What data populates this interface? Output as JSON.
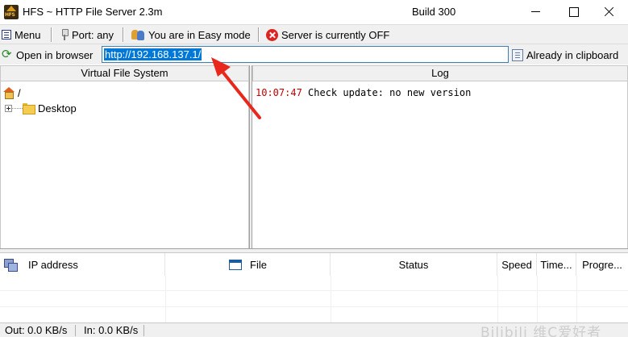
{
  "window": {
    "title": "HFS ~ HTTP File Server 2.3m",
    "build": "Build 300"
  },
  "toolbar1": {
    "menu_label": "Menu",
    "port_label": "Port: any",
    "mode_label": "You are in Easy mode",
    "server_label": "Server is currently OFF"
  },
  "toolbar2": {
    "open_browser_label": "Open in browser",
    "url_value": "http://192.168.137.1/",
    "clipboard_label": "Already in clipboard"
  },
  "vfs": {
    "header": "Virtual File System",
    "root_label": "/",
    "items": [
      {
        "label": "Desktop",
        "icon": "folder-icon"
      }
    ]
  },
  "log": {
    "header": "Log",
    "entries": [
      {
        "time": "10:07:47",
        "message": "Check update: no new version"
      }
    ]
  },
  "connections": {
    "columns": {
      "ip": "IP address",
      "file": "File",
      "status": "Status",
      "speed": "Speed",
      "time": "Time...",
      "progress": "Progre..."
    }
  },
  "statusbar": {
    "out": "Out: 0.0 KB/s",
    "in": "In: 0.0 KB/s"
  },
  "watermark": "Bilibili 维C爱好者",
  "colors": {
    "selection": "#0078d7",
    "log_time": "#c00000",
    "annotation_arrow": "#e8281c",
    "server_off": "#dd2222"
  }
}
